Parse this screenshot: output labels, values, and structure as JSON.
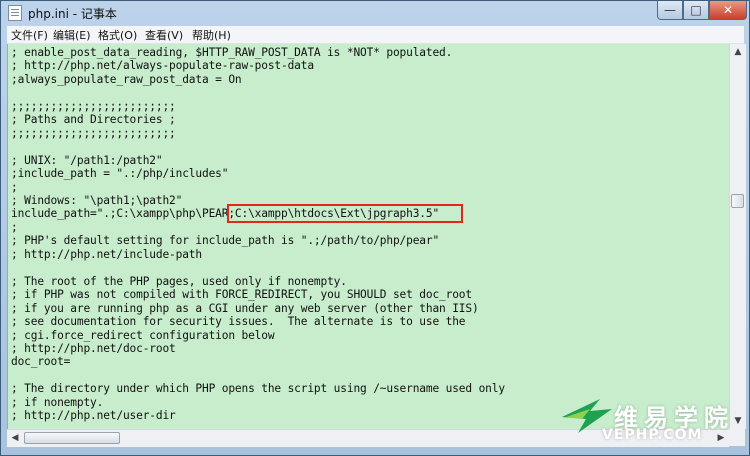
{
  "window": {
    "title": "php.ini - 记事本",
    "minimize_glyph": "—",
    "maximize_glyph": "□",
    "close_glyph": "✕",
    "accent_close": "#c8402b"
  },
  "menu": [
    {
      "label": "文件(F)"
    },
    {
      "label": "编辑(E)"
    },
    {
      "label": "格式(O)"
    },
    {
      "label": "查看(V)"
    },
    {
      "label": "帮助(H)"
    }
  ],
  "editor": {
    "background": "#c7edcc",
    "lines": [
      "; enable_post_data_reading, $HTTP_RAW_POST_DATA is *NOT* populated.",
      "; http://php.net/always-populate-raw-post-data",
      ";always_populate_raw_post_data = On",
      "",
      ";;;;;;;;;;;;;;;;;;;;;;;;;",
      "; Paths and Directories ;",
      ";;;;;;;;;;;;;;;;;;;;;;;;;",
      "",
      "; UNIX: \"/path1:/path2\"",
      ";include_path = \".:/php/includes\"",
      ";",
      "; Windows: \"\\path1;\\path2\"",
      "include_path=\".;C:\\xampp\\php\\PEAR;C:\\xampp\\htdocs\\Ext\\jpgraph3.5\"",
      ";",
      "; PHP's default setting for include_path is \".;/path/to/php/pear\"",
      "; http://php.net/include-path",
      "",
      "; The root of the PHP pages, used only if nonempty.",
      "; if PHP was not compiled with FORCE_REDIRECT, you SHOULD set doc_root",
      "; if you are running php as a CGI under any web server (other than IIS)",
      "; see documentation for security issues.  The alternate is to use the",
      "; cgi.force_redirect configuration below",
      "; http://php.net/doc-root",
      "doc_root=",
      "",
      "; The directory under which PHP opens the script using /~username used only",
      "; if nonempty.",
      "; http://php.net/user-dir"
    ],
    "highlight_color": "#e0291c"
  },
  "scrollbar": {
    "up_glyph": "▲",
    "down_glyph": "▼",
    "left_glyph": "◀",
    "right_glyph": "▶"
  },
  "watermark": {
    "cn": "维易学院",
    "en": "VEPHP.COM",
    "logo_colors": [
      "#1ea24f",
      "#8fd14f"
    ]
  }
}
